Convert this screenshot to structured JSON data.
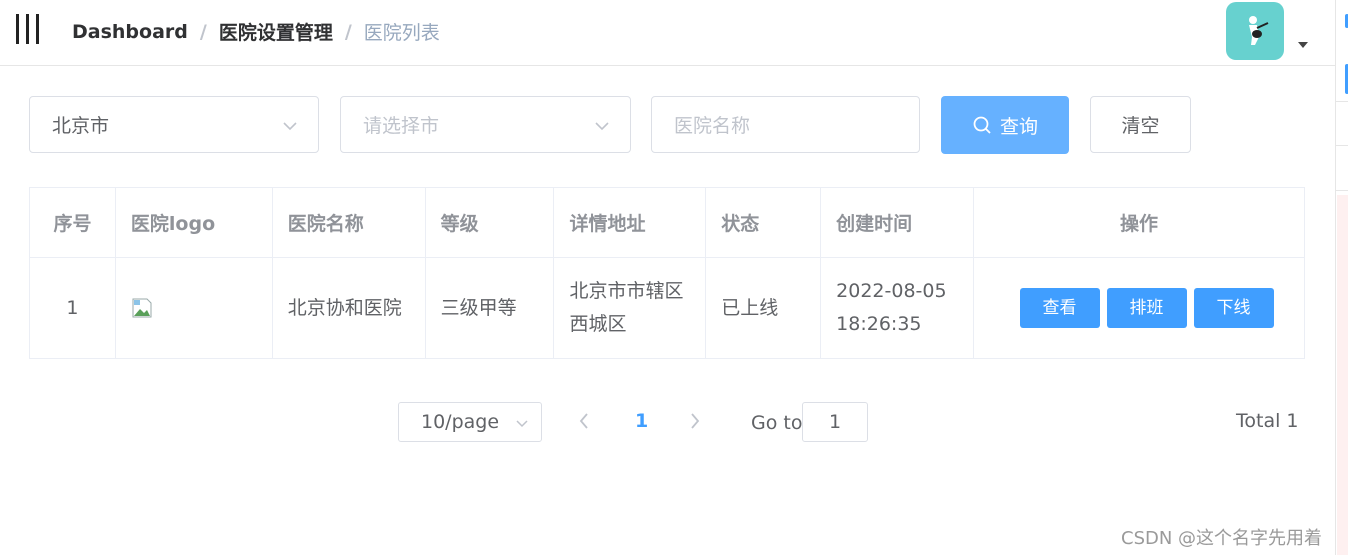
{
  "navbar": {
    "breadcrumb": [
      "Dashboard",
      "医院设置管理",
      "医院列表"
    ],
    "separator": "/"
  },
  "filters": {
    "province_value": "北京市",
    "city_placeholder": "请选择市",
    "name_placeholder": "医院名称",
    "query_label": "查询",
    "clear_label": "清空"
  },
  "table": {
    "headers": [
      "序号",
      "医院logo",
      "医院名称",
      "等级",
      "详情地址",
      "状态",
      "创建时间",
      "操作"
    ],
    "rows": [
      {
        "index": "1",
        "name": "北京协和医院",
        "level": "三级甲等",
        "address": "北京市市辖区西城区",
        "status": "已上线",
        "created": "2022-08-05 18:26:35",
        "actions": [
          "查看",
          "排班",
          "下线"
        ]
      }
    ]
  },
  "pagination": {
    "page_size": "10/page",
    "current_page": "1",
    "goto_label": "Go to",
    "goto_value": "1",
    "total": "Total 1"
  },
  "watermark": "CSDN @这个名字先用着",
  "colors": {
    "primary": "#409eff",
    "primary_light": "#66b1ff",
    "avatar_bg": "#67d1cf"
  }
}
